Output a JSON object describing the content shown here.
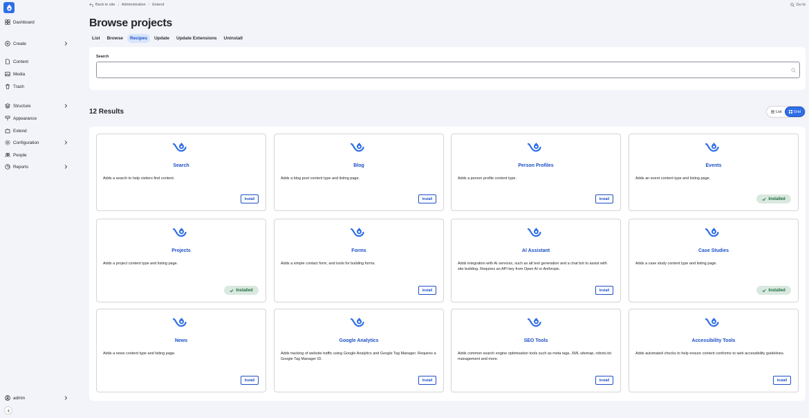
{
  "sidebar": {
    "items": [
      {
        "label": "Dashboard",
        "icon": "dashboard-icon",
        "chevron": false
      },
      {
        "label": "Create",
        "icon": "plus-circle-icon",
        "chevron": true
      },
      {
        "label": "Content",
        "icon": "file-icon",
        "chevron": false
      },
      {
        "label": "Media",
        "icon": "image-icon",
        "chevron": false
      },
      {
        "label": "Trash",
        "icon": "trash-icon",
        "chevron": false
      },
      {
        "label": "Structure",
        "icon": "layers-icon",
        "chevron": true
      },
      {
        "label": "Appearance",
        "icon": "paint-brush-icon",
        "chevron": false
      },
      {
        "label": "Extend",
        "icon": "puzzle-icon",
        "chevron": false
      },
      {
        "label": "Configuration",
        "icon": "gear-icon",
        "chevron": true
      },
      {
        "label": "People",
        "icon": "people-icon",
        "chevron": false
      },
      {
        "label": "Reports",
        "icon": "chart-icon",
        "chevron": true
      }
    ],
    "user": {
      "label": "admin",
      "icon": "user-icon"
    }
  },
  "topbar": {
    "back": "Back to site",
    "crumb1": "Administration",
    "crumb2": "Extend",
    "goto": "Go to"
  },
  "page": {
    "title": "Browse projects",
    "tabs": [
      "List",
      "Browse",
      "Recipes",
      "Update",
      "Update Extensions",
      "Uninstall"
    ],
    "active_tab": "Recipes"
  },
  "search": {
    "label": "Search",
    "value": ""
  },
  "results": {
    "count_label": "12 Results",
    "view_list": "List",
    "view_grid": "Grid"
  },
  "cards": [
    {
      "title": "Search",
      "desc": "Adds a search to help visitors find content.",
      "status": "install"
    },
    {
      "title": "Blog",
      "desc": "Adds a blog post content type and listing page.",
      "status": "install"
    },
    {
      "title": "Person Profiles",
      "desc": "Adds a person profile content type.",
      "status": "install"
    },
    {
      "title": "Events",
      "desc": "Adds an event content type and listing page.",
      "status": "installed"
    },
    {
      "title": "Projects",
      "desc": "Adds a project content type and listing page.",
      "status": "installed"
    },
    {
      "title": "Forms",
      "desc": "Adds a simple contact form, and tools for building forms.",
      "status": "install"
    },
    {
      "title": "AI Assistant",
      "desc": "Adds integration with AI services, such as alt text generation and a chat bot to assist with site building. Requires an API key from Open AI or Anthropic.",
      "status": "install"
    },
    {
      "title": "Case Studies",
      "desc": "Adds a case study content type and listing page.",
      "status": "installed"
    },
    {
      "title": "News",
      "desc": "Adds a news content type and listing page.",
      "status": "install"
    },
    {
      "title": "Google Analytics",
      "desc": "Adds tracking of website traffic using Google Analytics and Google Tag Manager. Requires a Google Tag Manager ID.",
      "status": "install"
    },
    {
      "title": "SEO Tools",
      "desc": "Adds common search engine optimisation tools such as meta tags, XML sitemap, robots.txt management and more.",
      "status": "install"
    },
    {
      "title": "Accessibility Tools",
      "desc": "Adds automated checks to help ensure content conforms to web accessibility guidelines.",
      "status": "install"
    }
  ],
  "labels": {
    "install": "Install",
    "installed": "Installed"
  },
  "colors": {
    "accent": "#2f6ee6",
    "link": "#1b4fc6",
    "installed_bg": "#d9e9df",
    "installed_fg": "#1f6b3b"
  }
}
